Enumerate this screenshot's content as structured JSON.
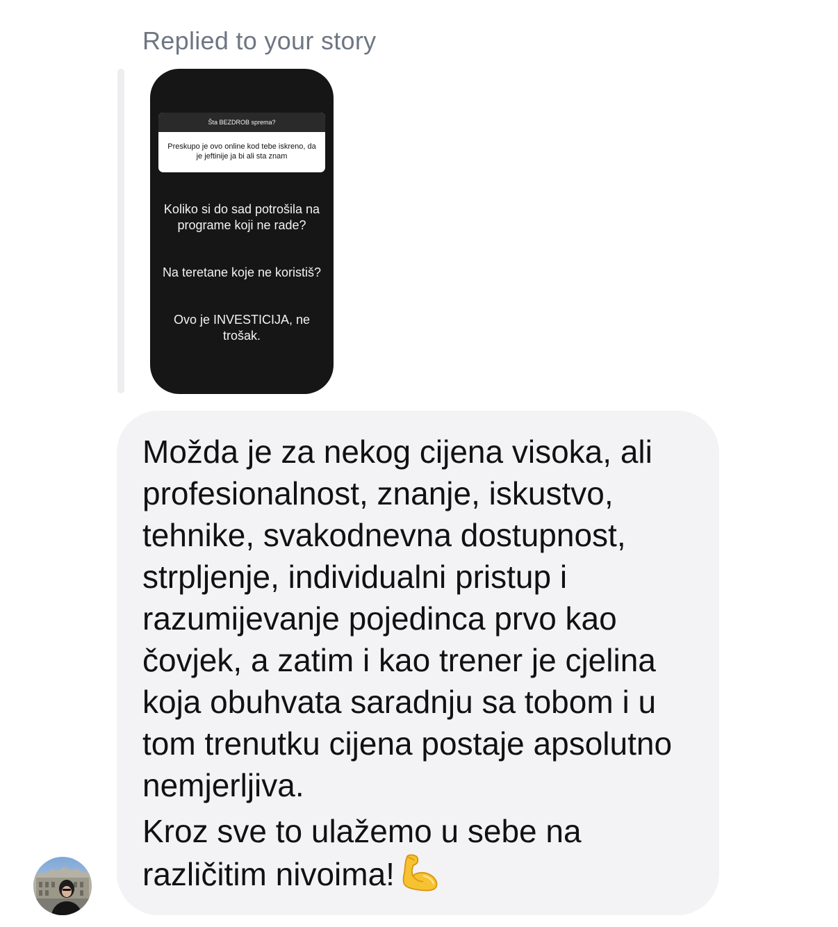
{
  "reply_context": {
    "label": "Replied to your story"
  },
  "story": {
    "question_header": "Šta BEZDROB sprema?",
    "question_answer": "Preskupo je ovo online kod tebe iskreno, da je jeftinije ja bi ali sta znam",
    "paragraph_1": "Koliko si do sad potrošila na programe koji ne rade?",
    "paragraph_2": "Na teretane koje ne koristiš?",
    "paragraph_3": "Ovo je INVESTICIJA, ne trošak."
  },
  "message": {
    "paragraph_1": "Možda je za nekog cijena visoka, ali profesionalnost, znanje, iskustvo, tehnike, svakodnevna dostupnost, strpljenje, individualni pristup i razumijevanje pojedinca prvo kao čovjek, a zatim i kao trener je cjelina koja obuhvata saradnju sa tobom i u tom trenutku cijena postaje apsolutno nemjerljiva.",
    "paragraph_2": "Kroz sve to ulažemo u sebe na različitim nivoima!",
    "emoji": "flexed-biceps-emoji"
  },
  "sender": {
    "avatar": "profile-photo"
  },
  "colors": {
    "bubble": "#f3f3f5",
    "story_background": "#161616",
    "label_gray": "#6e7682",
    "text": "#111111"
  }
}
